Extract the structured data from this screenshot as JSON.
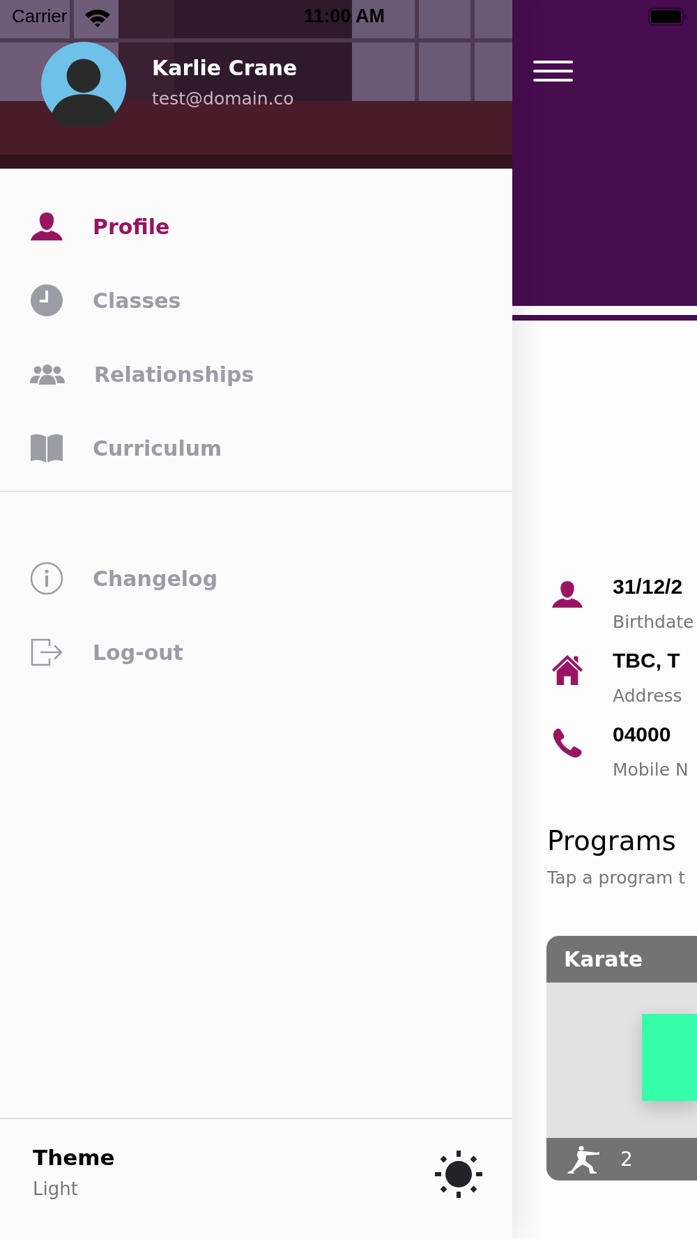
{
  "status_bar": {
    "carrier": "Carrier",
    "time": "11:00 AM"
  },
  "drawer": {
    "user": {
      "name": "Karlie Crane",
      "email": "test@domain.co"
    },
    "nav_items": [
      {
        "label": "Profile",
        "kind": "person",
        "selected": true
      },
      {
        "label": "Classes",
        "kind": "clock",
        "selected": false
      },
      {
        "label": "Relationships",
        "kind": "group",
        "selected": false
      },
      {
        "label": "Curriculum",
        "kind": "book",
        "selected": false
      }
    ],
    "secondary_items": [
      {
        "label": "Changelog",
        "kind": "info"
      },
      {
        "label": "Log-out",
        "kind": "logout"
      }
    ],
    "theme": {
      "title": "Theme",
      "value": "Light",
      "dark_mode": false
    }
  },
  "profile": {
    "details": [
      {
        "kind": "person",
        "value": "31/12/2",
        "label": "Birthdate"
      },
      {
        "kind": "home",
        "value": "TBC, T",
        "label": "Address"
      },
      {
        "kind": "phone",
        "value": "04000",
        "label": "Mobile N"
      }
    ],
    "programs": {
      "title": "Programs",
      "subtitle": "Tap a program t",
      "cards": [
        {
          "name": "Karate",
          "count": "2"
        }
      ]
    }
  }
}
